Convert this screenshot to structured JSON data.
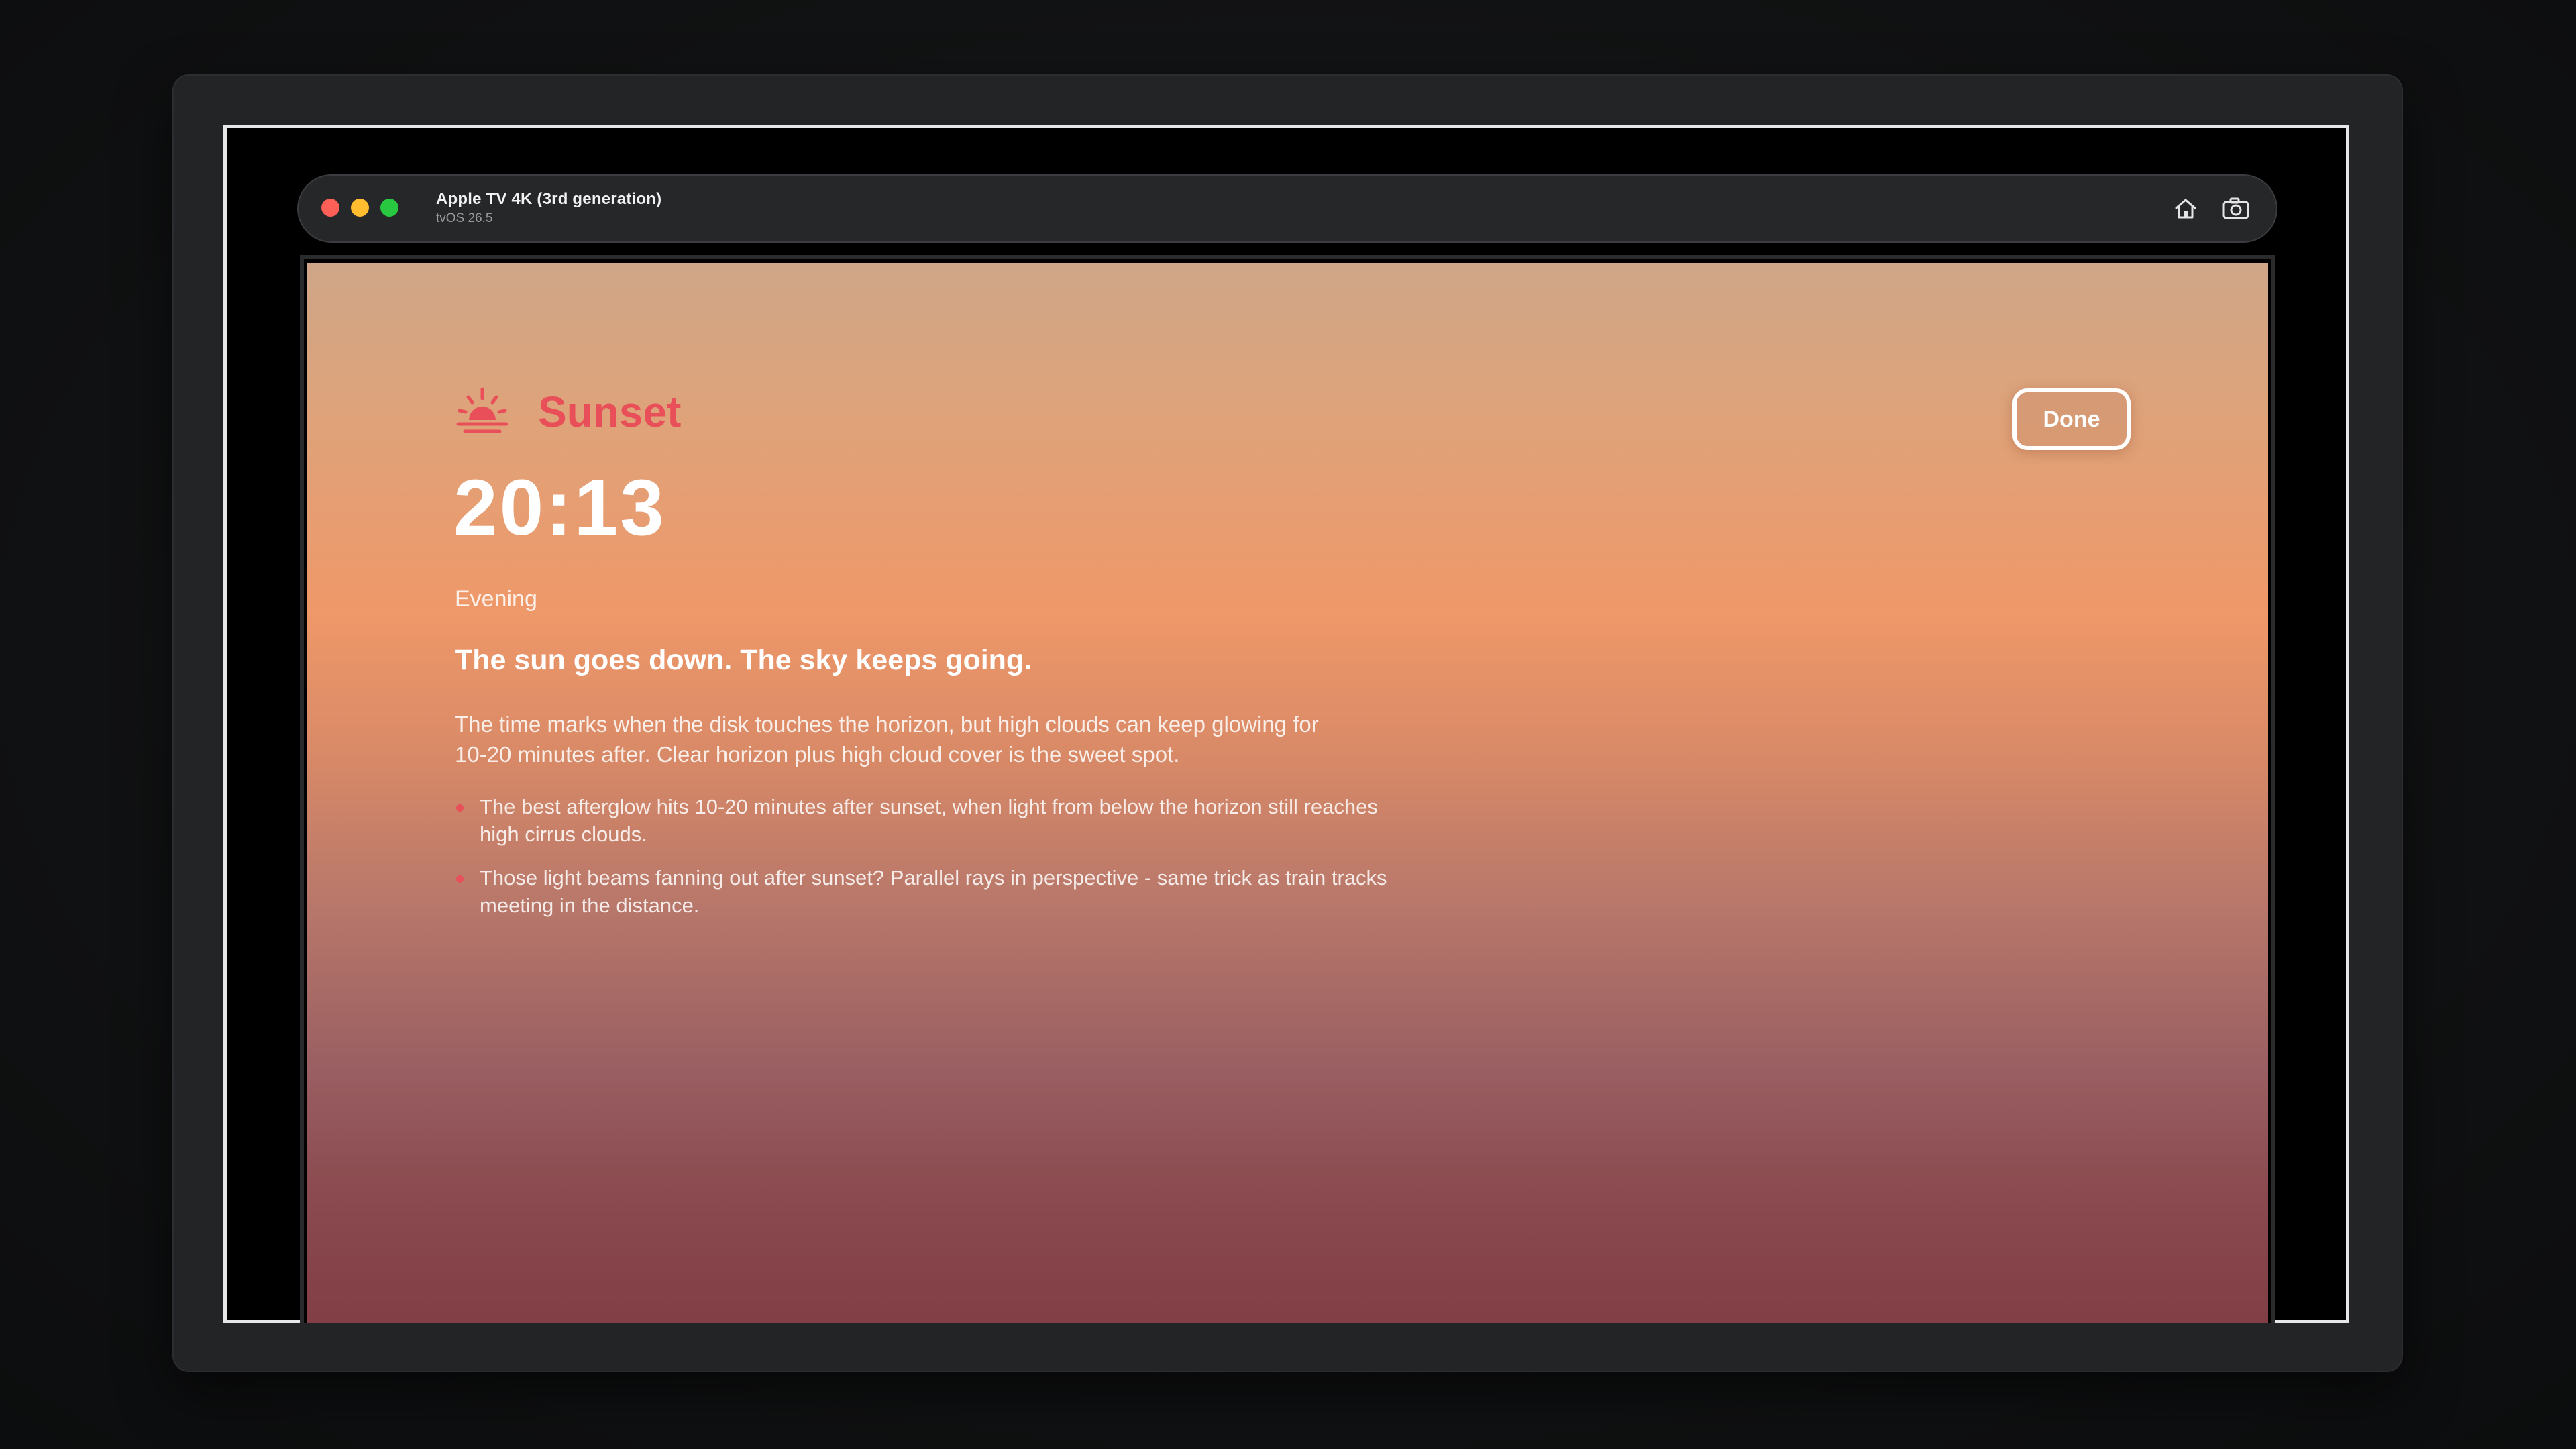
{
  "simulator": {
    "device_name": "Apple TV 4K (3rd generation)",
    "os_version": "tvOS 26.5",
    "icons": [
      "home-icon",
      "screenshot-camera-icon"
    ]
  },
  "detail": {
    "icon": "sunset-icon",
    "title": "Sunset",
    "time": "20:13",
    "period": "Evening",
    "headline": "The sun goes down. The sky keeps going.",
    "body_line1": "The time marks when the disk touches the horizon, but high clouds can keep glowing for",
    "body_line2": "10-20 minutes after. Clear horizon plus high cloud cover is the sweet spot.",
    "tips": [
      {
        "line1": "The best afterglow hits 10-20 minutes after sunset, when light from below the horizon still reaches",
        "line2": "high cirrus clouds."
      },
      {
        "line1": "Those light beams fanning out after sunset? Parallel rays in perspective - same trick as train tracks",
        "line2": "meeting in the distance."
      }
    ],
    "done_label": "Done"
  },
  "colors": {
    "accent": "#e84f59",
    "gradient_top": "#cfa688",
    "gradient_mid": "#ef9869",
    "gradient_bottom": "#823f45"
  }
}
